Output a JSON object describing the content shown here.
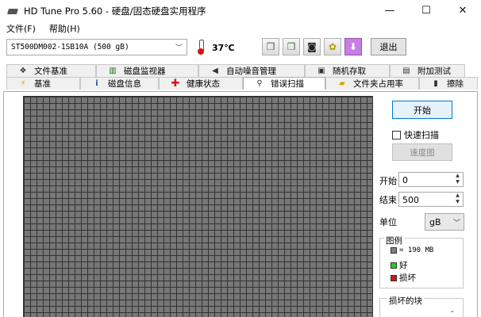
{
  "window": {
    "title": "HD Tune Pro 5.60 - 硬盘/固态硬盘实用程序",
    "minimize": "—",
    "maximize": "☐",
    "close": "✕"
  },
  "menu": {
    "file": "文件(F)",
    "help": "帮助(H)"
  },
  "toolbar": {
    "drive": "ST500DM002-1SB10A (500 gB)",
    "temperature": "37℃",
    "exit_label": "退出",
    "icons": [
      "copy-info-icon",
      "copy-text-icon",
      "screenshot-icon",
      "options-icon",
      "save-icon"
    ]
  },
  "tabs_row1": [
    {
      "label": "文件基准",
      "icon": "file-benchmark-icon"
    },
    {
      "label": "磁盘监视器",
      "icon": "disk-monitor-icon"
    },
    {
      "label": "自动噪音管理",
      "icon": "aam-icon"
    },
    {
      "label": "随机存取",
      "icon": "random-access-icon"
    },
    {
      "label": "附加测试",
      "icon": "extra-tests-icon"
    }
  ],
  "tabs_row2": [
    {
      "label": "基准",
      "icon": "benchmark-icon"
    },
    {
      "label": "磁盘信息",
      "icon": "info-icon"
    },
    {
      "label": "健康状态",
      "icon": "health-icon"
    },
    {
      "label": "错误扫描",
      "icon": "error-scan-icon",
      "active": true
    },
    {
      "label": "文件夹占用率",
      "icon": "folder-usage-icon"
    },
    {
      "label": "擦除",
      "icon": "erase-icon"
    }
  ],
  "scan": {
    "start_label": "开始",
    "quick_scan_label": "快速扫描",
    "quick_scan_checked": false,
    "speed_map_label": "速度图",
    "start_field_label": "开始",
    "start_value": "0",
    "end_field_label": "结束",
    "end_value": "500",
    "unit_label": "单位",
    "unit_value": "gB"
  },
  "legend": {
    "title": "图例",
    "block_size": "= 190 MB",
    "good": "好",
    "damaged": "损坏",
    "block_color": "#808080",
    "good_color": "#22cc22",
    "damaged_color": "#d21414"
  },
  "damaged_blocks": {
    "title": "损坏的块",
    "value": "-"
  }
}
